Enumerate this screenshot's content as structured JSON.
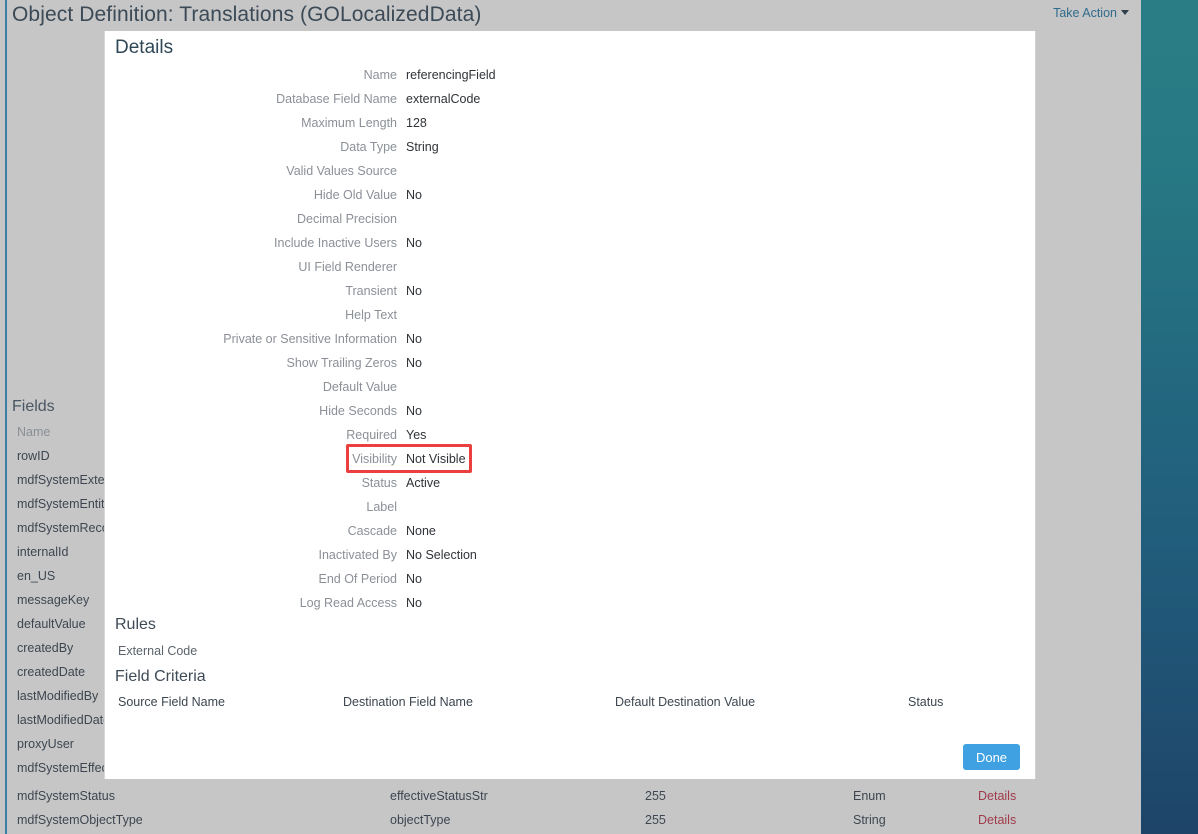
{
  "header": {
    "title": "Object Definition: Translations (GOLocalizedData)",
    "take_action_label": "Take Action",
    "caret_icon": "chevron-down-icon"
  },
  "theme": {
    "page_background": "#c6c6c6",
    "desktop_gradient_top": "#2b7d85",
    "desktop_gradient_bottom": "#1e4468",
    "modal_background": "#ffffff",
    "heading_color": "#2f4858",
    "label_color": "#8b9097",
    "value_color": "#2f3338",
    "primary_button": "#3fa0e2",
    "highlight_outline": "#ec3f3f",
    "link_color": "#a13b4a",
    "accent_line": "#3f7ea6"
  },
  "sidebar": {
    "heading": "Fields",
    "column_header": "Name",
    "items": [
      {
        "label": "rowID"
      },
      {
        "label": "mdfSystemExter"
      },
      {
        "label": "mdfSystemEntity"
      },
      {
        "label": "mdfSystemReco"
      },
      {
        "label": "internalId"
      },
      {
        "label": "en_US"
      },
      {
        "label": "messageKey"
      },
      {
        "label": "defaultValue"
      },
      {
        "label": "createdBy"
      },
      {
        "label": "createdDate"
      },
      {
        "label": "lastModifiedBy"
      },
      {
        "label": "lastModifiedDate"
      },
      {
        "label": "proxyUser"
      },
      {
        "label": "mdfSystemEffect"
      }
    ]
  },
  "background_table": {
    "rows": [
      {
        "name": "mdfSystemStatus",
        "database_field": "effectiveStatusStr",
        "length": "255",
        "type": "Enum",
        "details_link": "Details"
      },
      {
        "name": "mdfSystemObjectType",
        "database_field": "objectType",
        "length": "255",
        "type": "String",
        "details_link": "Details"
      }
    ]
  },
  "modal": {
    "title": "Details",
    "fields": [
      {
        "label": "Name",
        "value": "referencingField"
      },
      {
        "label": "Database Field Name",
        "value": "externalCode"
      },
      {
        "label": "Maximum Length",
        "value": "128"
      },
      {
        "label": "Data Type",
        "value": "String"
      },
      {
        "label": "Valid Values Source",
        "value": ""
      },
      {
        "label": "Hide Old Value",
        "value": "No"
      },
      {
        "label": "Decimal Precision",
        "value": ""
      },
      {
        "label": "Include Inactive Users",
        "value": "No"
      },
      {
        "label": "UI Field Renderer",
        "value": ""
      },
      {
        "label": "Transient",
        "value": "No"
      },
      {
        "label": "Help Text",
        "value": ""
      },
      {
        "label": "Private or Sensitive Information",
        "value": "No"
      },
      {
        "label": "Show Trailing Zeros",
        "value": "No"
      },
      {
        "label": "Default Value",
        "value": ""
      },
      {
        "label": "Hide Seconds",
        "value": "No"
      },
      {
        "label": "Required",
        "value": "Yes"
      },
      {
        "label": "Visibility",
        "value": "Not Visible"
      },
      {
        "label": "Status",
        "value": "Active"
      },
      {
        "label": "Label",
        "value": ""
      },
      {
        "label": "Cascade",
        "value": "None"
      },
      {
        "label": "Inactivated By",
        "value": "No Selection"
      },
      {
        "label": "End Of Period",
        "value": "No"
      },
      {
        "label": "Log Read Access",
        "value": "No"
      }
    ],
    "rules": {
      "heading": "Rules",
      "items": [
        {
          "label": "External Code"
        }
      ]
    },
    "field_criteria": {
      "heading": "Field Criteria",
      "columns": [
        "Source Field Name",
        "Destination Field Name",
        "Default Destination Value",
        "Status"
      ],
      "rows": []
    },
    "done_label": "Done"
  }
}
